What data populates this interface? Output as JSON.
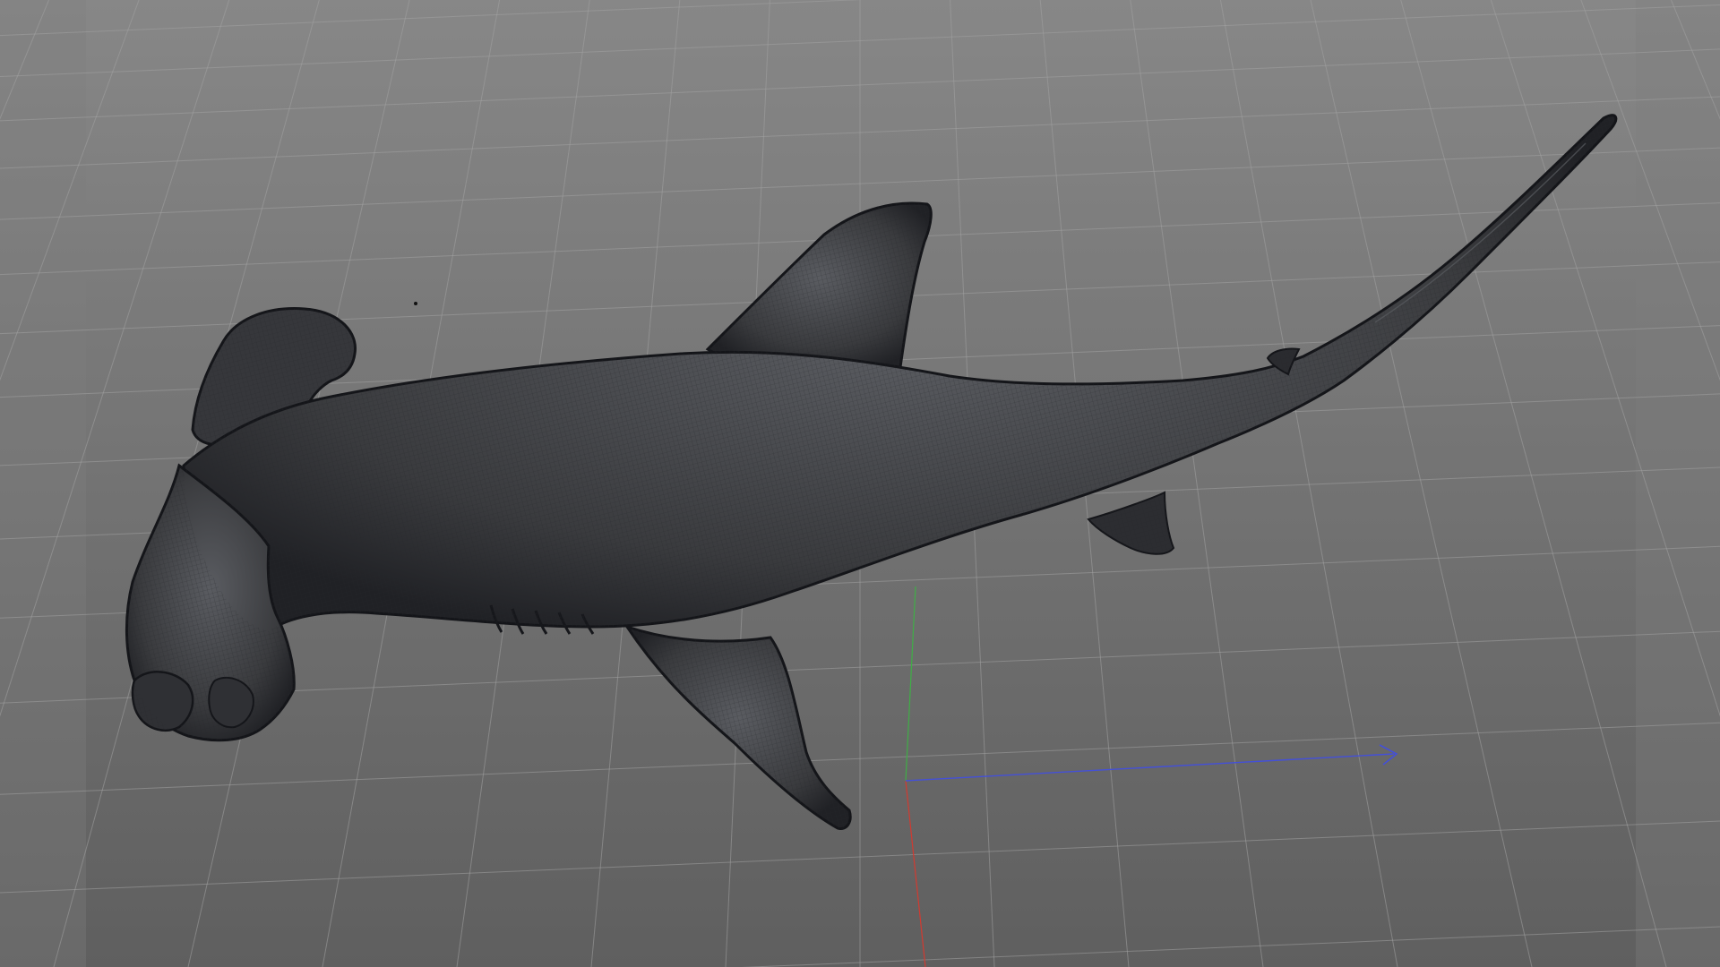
{
  "viewport": {
    "background_top": "#878787",
    "background_bottom": "#5f5f5f",
    "side_band_color": "#7e7e7e",
    "grid_color": "#a2a2a2",
    "grid_major_color": "#b4b4b4"
  },
  "axes": {
    "x_axis_color": "#4450d8",
    "y_axis_color": "#3fae46",
    "z_axis_color": "#d23a30",
    "x_arrow_icon": "arrow-right-icon"
  },
  "model": {
    "name": "hammerhead-shark",
    "display_mode": "wireframe-on-shaded",
    "body_color": "#3a3b3e",
    "edge_color": "#15161a",
    "highlight_color": "#5a5c61",
    "wire_color": "#2a2b2f"
  }
}
